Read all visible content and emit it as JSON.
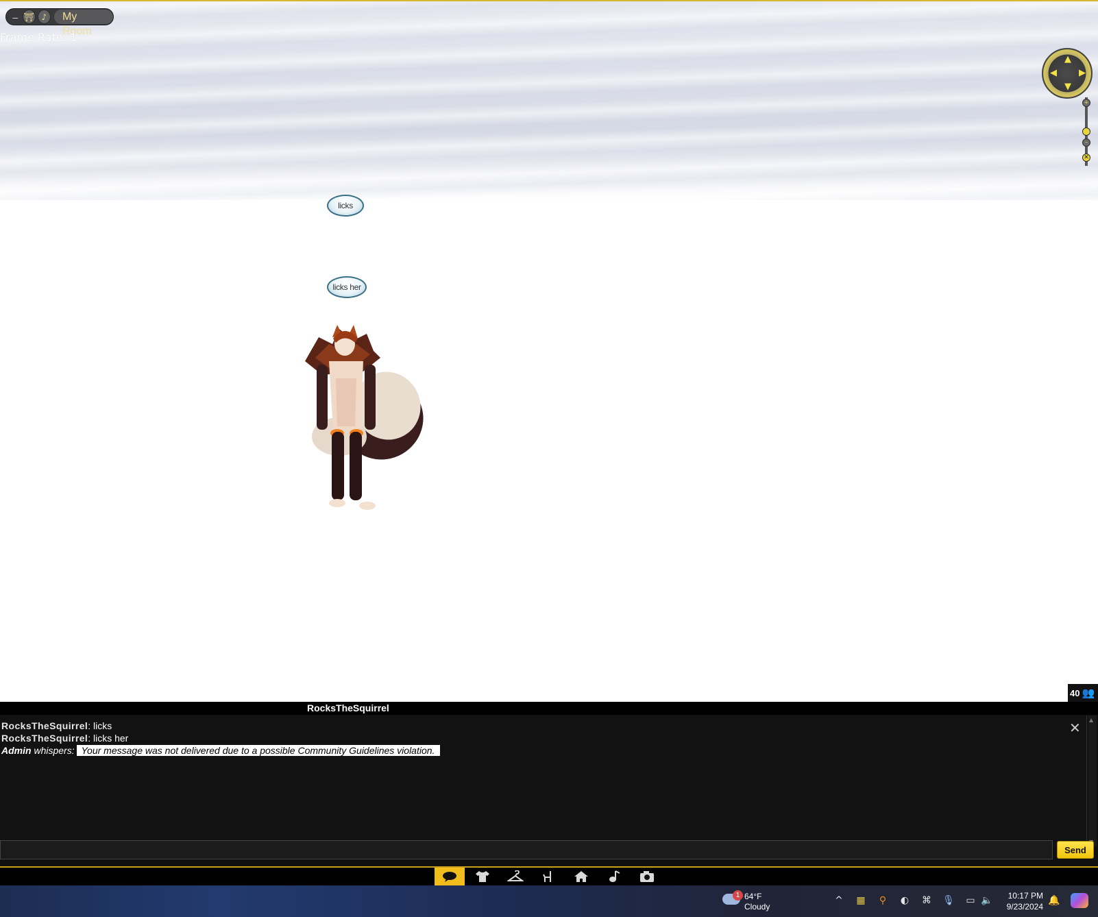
{
  "window": {
    "room_title": "My Room",
    "frame_rate_label": "Frame Rate: 1",
    "pill_min_glyph": "–",
    "pill_btn1_glyph": "⛩",
    "pill_btn2_glyph": "♪"
  },
  "nav": {
    "icons": [
      "nav-compass-icon",
      "zoom-slider-icon"
    ]
  },
  "bubbles": [
    {
      "text": "licks"
    },
    {
      "text": "licks her"
    }
  ],
  "chat": {
    "header_name": "RocksTheSquirrel",
    "user_count": "40",
    "messages": [
      {
        "name": "RocksTheSquirrel",
        "text": ": licks"
      },
      {
        "name": "RocksTheSquirrel",
        "text": ": licks her"
      },
      {
        "name": "Admin",
        "whisper": "whispers:",
        "text": "Your message was not delivered due to a possible Community Guidelines violation."
      }
    ],
    "input_value": "",
    "send_label": "Send",
    "close_glyph": "✕"
  },
  "toolbar": {
    "items": [
      {
        "icon": "chat-bubble-icon",
        "glyph": "💬"
      },
      {
        "icon": "shirt-icon",
        "glyph": "👕"
      },
      {
        "icon": "hanger-icon",
        "glyph": "⌂"
      },
      {
        "icon": "chair-icon",
        "glyph": "⑁"
      },
      {
        "icon": "home-icon",
        "glyph": "⌂"
      },
      {
        "icon": "music-note-icon",
        "glyph": "♪"
      },
      {
        "icon": "camera-icon",
        "glyph": "◉"
      }
    ],
    "accent": "#f1bd1c"
  },
  "taskbar": {
    "weather_badge": "1",
    "weather_temp": "64°F",
    "weather_cond": "Cloudy",
    "time": "10:17 PM",
    "date": "9/23/2024"
  }
}
